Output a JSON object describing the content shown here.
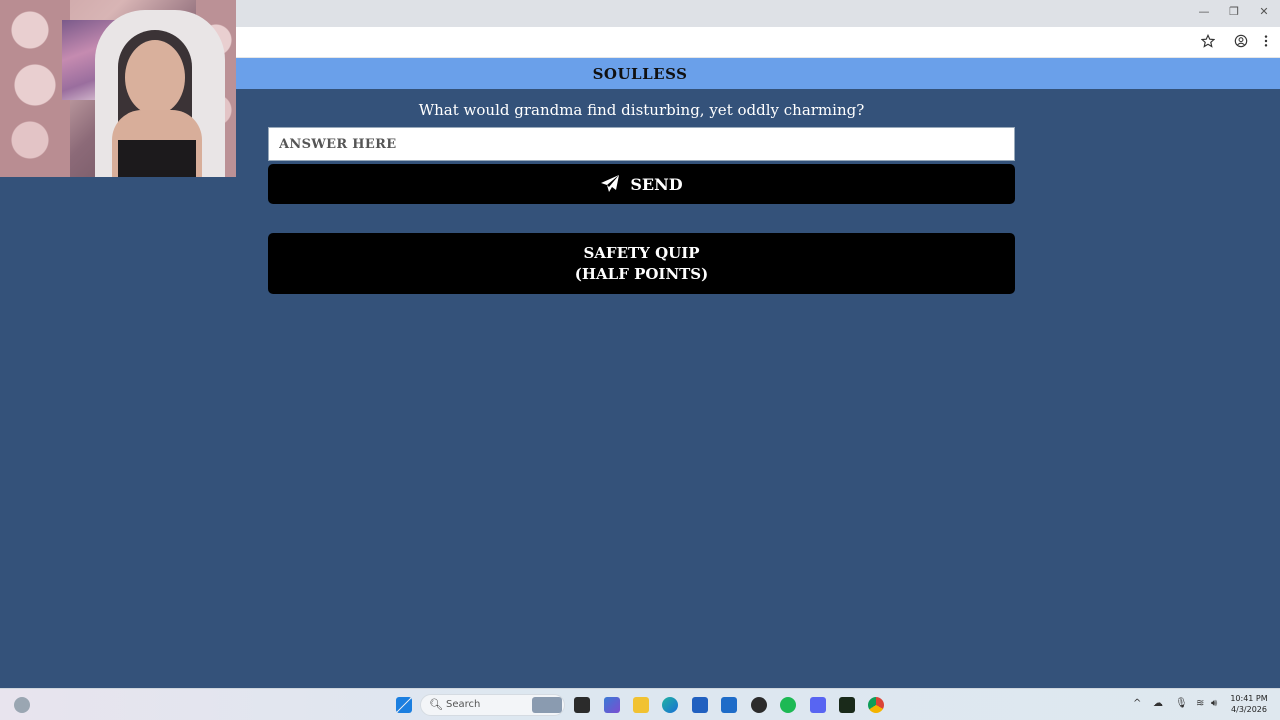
{
  "browser": {
    "window_controls": {
      "minimize": "—",
      "restore": "❐",
      "close": "✕"
    },
    "toolbar_icons": [
      "star-icon",
      "profile-icon",
      "menu-dots-icon"
    ]
  },
  "game": {
    "header_title": "SOULLESS",
    "prompt": "What would grandma find disturbing, yet oddly charming?",
    "answer_placeholder": "ANSWER HERE",
    "send_label": "SEND",
    "safety_quip_line1": "SAFETY QUIP",
    "safety_quip_line2": "(HALF POINTS)"
  },
  "taskbar": {
    "search_placeholder": "Search",
    "time": "10:41 PM",
    "date": "4/3/2026"
  },
  "colors": {
    "page_bg": "#34527a",
    "header_bg": "#6aa0ea",
    "button_bg": "#000000"
  }
}
